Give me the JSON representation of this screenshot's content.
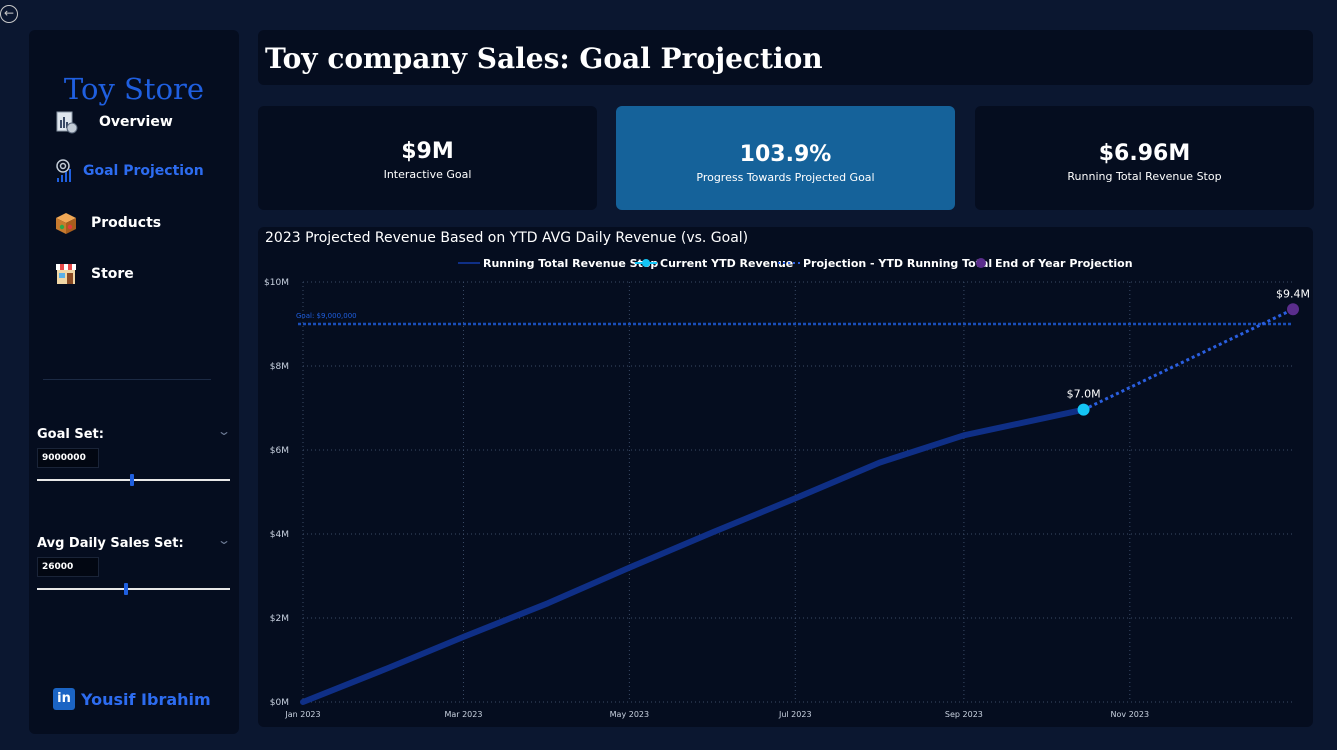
{
  "sidebar": {
    "brand": "Toy Store",
    "nav": [
      {
        "label": "Overview",
        "icon": "report-icon",
        "active": false
      },
      {
        "label": "Goal Projection",
        "icon": "target-icon",
        "active": true
      },
      {
        "label": "Products",
        "icon": "box-icon",
        "active": false
      },
      {
        "label": "Store",
        "icon": "store-icon",
        "active": false
      }
    ],
    "goal_set": {
      "label": "Goal Set:",
      "value": "9000000",
      "slider_level": 0.49
    },
    "avg_daily": {
      "label": "Avg Daily Sales Set:",
      "value": "26000",
      "slider_level": 0.46
    },
    "credit": {
      "icon_text": "in",
      "name": "Yousif Ibrahim"
    }
  },
  "header": {
    "title": "Toy company Sales: Goal Projection"
  },
  "kpis": [
    {
      "value": "$9M",
      "label": "Interactive Goal"
    },
    {
      "value": "103.9%",
      "label": "Progress Towards Projected Goal"
    },
    {
      "value": "$6.96M",
      "label": "Running Total Revenue Stop"
    }
  ],
  "colors": {
    "accent": "#1f5fe0",
    "running_total": "#0f2f86",
    "current_point": "#14c5f5",
    "projection": "#2a5fe0",
    "end_point": "#5a2d8c",
    "highlight_card": "#15629a"
  },
  "chart_data": {
    "type": "line",
    "title": "2023 Projected Revenue Based on YTD AVG Daily Revenue (vs. Goal)",
    "legend_position": "top",
    "series": [
      {
        "name": "Running Total Revenue Stop",
        "style": "solid line",
        "points": [
          [
            "2023-01-01",
            0
          ],
          [
            "2023-02-01",
            0.8
          ],
          [
            "2023-03-01",
            1.55
          ],
          [
            "2023-04-01",
            2.35
          ],
          [
            "2023-05-01",
            3.2
          ],
          [
            "2023-06-01",
            4.05
          ],
          [
            "2023-07-01",
            4.85
          ],
          [
            "2023-08-01",
            5.7
          ],
          [
            "2023-09-01",
            6.35
          ],
          [
            "2023-10-15",
            6.96
          ]
        ]
      },
      {
        "name": "Current YTD Revenue",
        "style": "point",
        "points": [
          [
            "2023-10-15",
            6.96
          ]
        ]
      },
      {
        "name": "Projection - YTD Running Total",
        "style": "dotted line",
        "points": [
          [
            "2023-10-15",
            6.96
          ],
          [
            "2023-12-31",
            9.35
          ]
        ]
      },
      {
        "name": "End of Year Projection",
        "style": "point",
        "points": [
          [
            "2023-12-31",
            9.35
          ]
        ]
      }
    ],
    "data_labels": [
      {
        "text": "$7.0M",
        "x": "2023-10-15",
        "y": 6.96
      },
      {
        "text": "$9.4M",
        "x": "2023-12-31",
        "y": 9.35
      }
    ],
    "reference_line": {
      "label": "Goal: $9,000,000",
      "value": 9.0
    },
    "y_unit": "$M",
    "ylim": [
      0,
      10
    ],
    "y_ticks": [
      {
        "value": 0,
        "label": "$0M"
      },
      {
        "value": 2,
        "label": "$2M"
      },
      {
        "value": 4,
        "label": "$4M"
      },
      {
        "value": 6,
        "label": "$6M"
      },
      {
        "value": 8,
        "label": "$8M"
      },
      {
        "value": 10,
        "label": "$10M"
      }
    ],
    "x_ticks": [
      {
        "value": "2023-01-01",
        "label": "Jan 2023"
      },
      {
        "value": "2023-03-01",
        "label": "Mar 2023"
      },
      {
        "value": "2023-05-01",
        "label": "May 2023"
      },
      {
        "value": "2023-07-01",
        "label": "Jul 2023"
      },
      {
        "value": "2023-09-01",
        "label": "Sep 2023"
      },
      {
        "value": "2023-11-01",
        "label": "Nov 2023"
      }
    ],
    "xlim": [
      "2023-01-01",
      "2023-12-31"
    ],
    "grid": true
  }
}
